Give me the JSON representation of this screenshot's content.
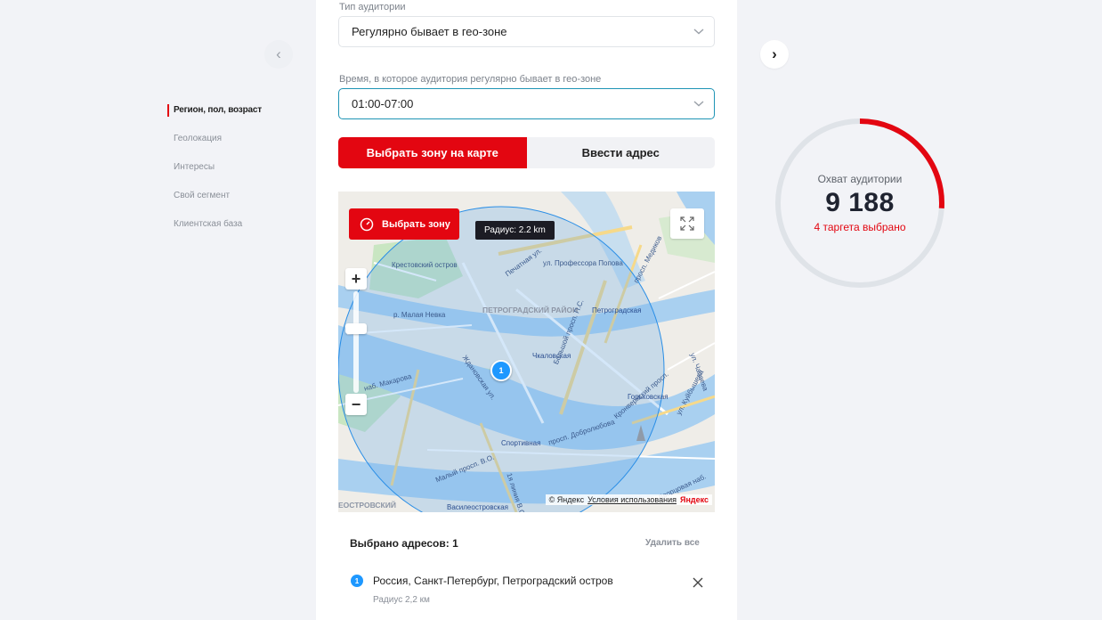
{
  "nav": {
    "prev": "‹",
    "next": "›"
  },
  "sidebar": {
    "items": [
      {
        "label": "Регион, пол, возраст",
        "active": true
      },
      {
        "label": "Геолокация"
      },
      {
        "label": "Интересы"
      },
      {
        "label": "Свой сегмент"
      },
      {
        "label": "Клиентская база"
      }
    ]
  },
  "form": {
    "audience_type_label": "Тип аудитории",
    "audience_type_value": "Регулярно бывает в гео-зоне",
    "time_label": "Время, в которое аудитория регулярно бывает в гео-зоне",
    "time_value": "01:00-07:00",
    "mode_map": "Выбрать зону на карте",
    "mode_address": "Ввести адрес"
  },
  "map": {
    "select_zone": "Выбрать зону",
    "radius_tooltip": "Радиус: 2.2 km",
    "zoom_in": "+",
    "zoom_out": "−",
    "pin_number": "1",
    "labels": {
      "krestovsky": "Крестовский остров",
      "petrogradsky": "ПЕТРОГРАДСКИЙ РАЙОН",
      "petrogradskaya": "Петроградская",
      "chkalovskaya": "Чкаловская",
      "gorkovskaya": "Горьковская",
      "sportivnaya": "Спортивная",
      "vasileostrovskaya": "Василеостровская",
      "malaya_nevka": "р. Малая Невка",
      "prof_popova": "ул. Профессора Попова",
      "bolshoy_pr": "Большой просп. П.С.",
      "dobrolyubova": "просп. Добролюбова",
      "kronverksky": "Кронверкский просп.",
      "zhdanovskaya": "Ждановская ул.",
      "makarova": "наб. Макарова",
      "maly_pr": "Малый просп. В.О.",
      "pechat": "Печатная ул.",
      "medikov": "просп. Медиков",
      "kuybysheva": "ул. Куйбышева",
      "chapaeva": "ул. Чапаева",
      "dvortsovaya": "Дворцовая наб.",
      "vasileostrovsky": "ЕОСТРОВСКИЙ",
      "liniya": "1я линия В.О."
    },
    "copyright_yandex": "© Яндекс",
    "terms": "Условия использования",
    "yandex_logo": "Яндекс"
  },
  "addresses": {
    "header": "Выбрано адресов: 1",
    "delete_all": "Удалить все",
    "items": [
      {
        "number": "1",
        "text": "Россия, Санкт-Петербург, Петроградский остров",
        "radius": "Радиус 2,2 км"
      }
    ]
  },
  "reach": {
    "label": "Охват аудитории",
    "value": "9 188",
    "targets": "4 таргета выбрано",
    "progress_fraction": 0.26,
    "accent_color": "#e30611",
    "track_color": "#dfe3e8"
  }
}
